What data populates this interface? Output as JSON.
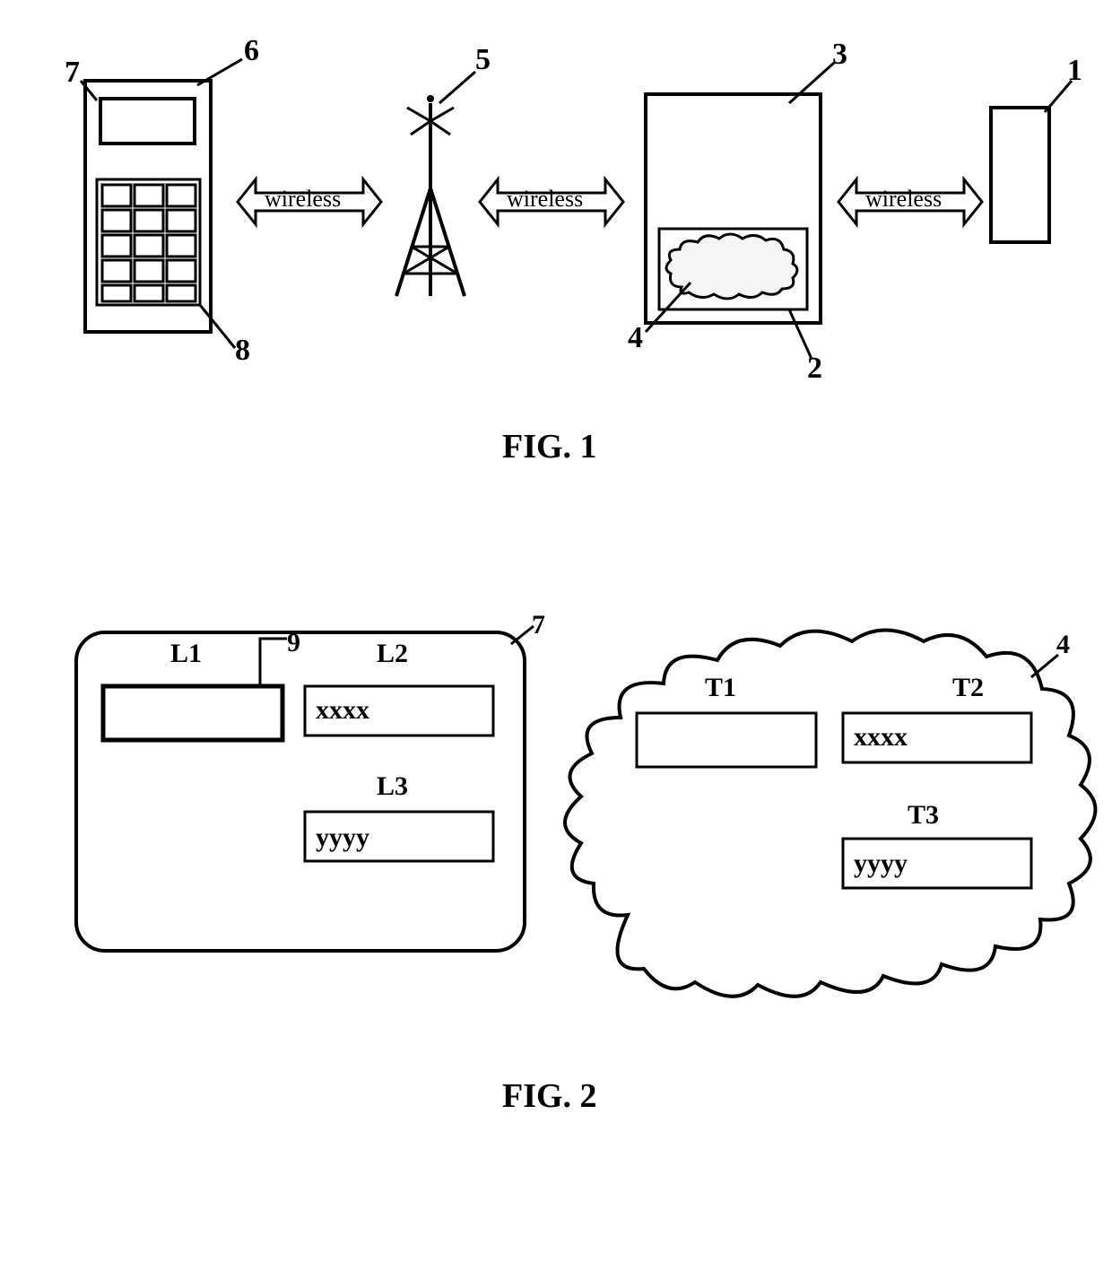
{
  "figure1": {
    "caption": "FIG. 1",
    "wireless_label": "wireless",
    "callouts": {
      "c1": "1",
      "c2": "2",
      "c3": "3",
      "c4": "4",
      "c5": "5",
      "c6": "6",
      "c7": "7",
      "c8": "8"
    }
  },
  "figure2": {
    "caption": "FIG. 2",
    "screen": {
      "L1": "L1",
      "L2": "L2",
      "L3": "L3",
      "L2_value": "xxxx",
      "L3_value": "yyyy",
      "c7": "7",
      "c9": "9"
    },
    "cloud": {
      "T1": "T1",
      "T2": "T2",
      "T3": "T3",
      "T2_value": "xxxx",
      "T3_value": "yyyy",
      "c4": "4"
    }
  }
}
